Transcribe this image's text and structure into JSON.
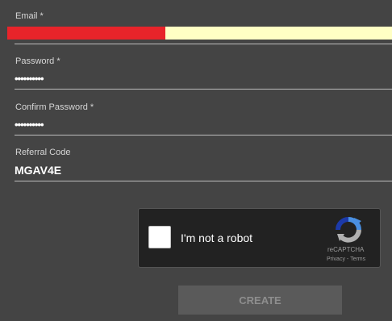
{
  "form": {
    "email": {
      "label": "Email *",
      "value": ""
    },
    "password": {
      "label": "Password *",
      "value": "••••••••••"
    },
    "confirm_password": {
      "label": "Confirm Password *",
      "value": "••••••••••"
    },
    "referral": {
      "label": "Referral Code",
      "value": "MGAV4E"
    }
  },
  "captcha": {
    "checkbox_label": "I'm not a robot",
    "brand": "reCAPTCHA",
    "privacy_link": "Privacy",
    "separator": " - ",
    "terms_link": "Terms",
    "icon": "recaptcha-logo-icon"
  },
  "create_button": {
    "label": "CREATE"
  },
  "colors": {
    "background": "#444444",
    "email_redaction": "#e8242a",
    "email_autofill": "#ffffc4",
    "button_disabled": "#5a5a5a"
  }
}
